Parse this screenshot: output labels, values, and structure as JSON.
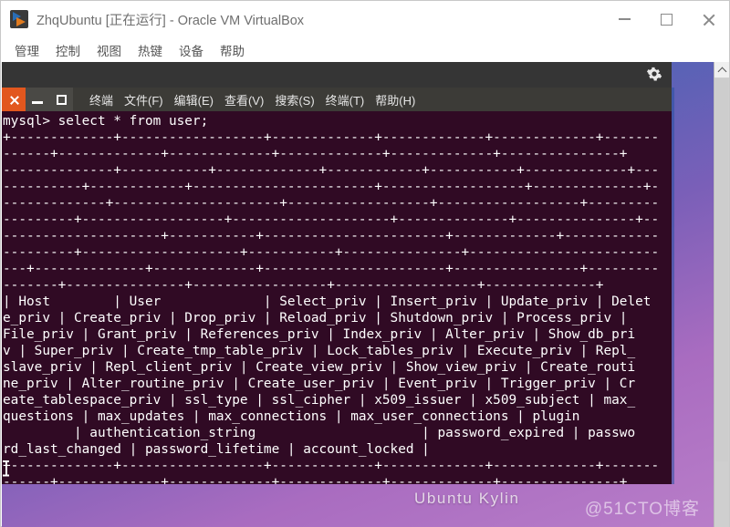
{
  "host_window": {
    "title": "ZhqUbuntu [正在运行] - Oracle VM VirtualBox",
    "app_icon": "virtualbox-icon",
    "controls": {
      "minimize": "minimize-icon",
      "maximize": "maximize-icon",
      "close": "close-icon"
    },
    "menubar": [
      {
        "label": "管理"
      },
      {
        "label": "控制"
      },
      {
        "label": "视图"
      },
      {
        "label": "热键"
      },
      {
        "label": "设备"
      },
      {
        "label": "帮助"
      }
    ]
  },
  "guest": {
    "desktop_label": "Ubuntu Kylin",
    "watermark": "@51CTO博客",
    "panel": {
      "tray_icon": "gear-icon"
    },
    "scrollbar": {
      "up_arrow": "chevron-up-icon"
    }
  },
  "terminal": {
    "controls": {
      "close": "close-icon",
      "minimize": "minimize-icon",
      "maximize": "maximize-icon"
    },
    "menubar": [
      {
        "label": "终端"
      },
      {
        "label": "文件(F)"
      },
      {
        "label": "编辑(E)"
      },
      {
        "label": "查看(V)"
      },
      {
        "label": "搜索(S)"
      },
      {
        "label": "终端(T)"
      },
      {
        "label": "帮助(H)"
      }
    ],
    "prompt": "mysql>",
    "command": "select * from user;",
    "cursor": "text-cursor-ibeam",
    "lines": [
      "mysql> select * from user;",
      "+-------------+------------------+-------------+-------------+-------------+-------",
      "------+-------------+-------------+-------------+-------------+---------------+",
      "--------------+-----------+-------------+------------+-----------+-------------+---",
      "----------+------------+-----------------------+------------------+--------------+-",
      "-------------+---------------------+------------------+------------------+---------",
      "---------+------------------+--------------------+--------------+---------------+--",
      "--------------------+-----------+-----------------------+-------------+------------",
      "---------+--------------------+-----------+---------------+------------------------",
      "---+--------------+-------------+-----------------------+----------------+---------",
      "-------+---------------+-----------------+------------------+--------------+",
      "| Host        | User             | Select_priv | Insert_priv | Update_priv | Delet",
      "e_priv | Create_priv | Drop_priv | Reload_priv | Shutdown_priv | Process_priv |",
      "File_priv | Grant_priv | References_priv | Index_priv | Alter_priv | Show_db_pri",
      "v | Super_priv | Create_tmp_table_priv | Lock_tables_priv | Execute_priv | Repl_",
      "slave_priv | Repl_client_priv | Create_view_priv | Show_view_priv | Create_routi",
      "ne_priv | Alter_routine_priv | Create_user_priv | Event_priv | Trigger_priv | Cr",
      "eate_tablespace_priv | ssl_type | ssl_cipher | x509_issuer | x509_subject | max_",
      "questions | max_updates | max_connections | max_user_connections | plugin",
      "         | authentication_string                     | password_expired | passwo",
      "rd_last_changed | password_lifetime | account_locked |",
      "+-------------+------------------+-------------+-------------+-------------+-------",
      "------+-------------+-------------+-------------+-------------+---------------+",
      "--------------+-----------+-------------+------------+-----------+-------------+---"
    ]
  }
}
